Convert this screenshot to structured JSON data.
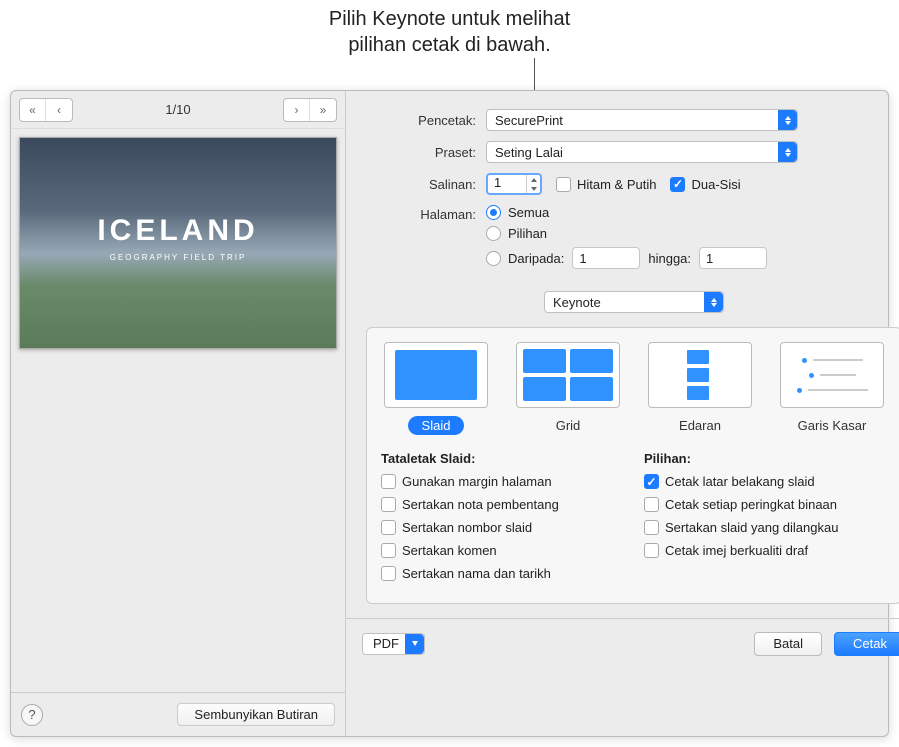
{
  "annotation": {
    "line1": "Pilih Keynote untuk melihat",
    "line2": "pilihan cetak di bawah."
  },
  "preview": {
    "page_indicator": "1/10",
    "slide_title": "ICELAND",
    "slide_subtitle": "GEOGRAPHY FIELD TRIP"
  },
  "left_footer": {
    "hide_details": "Sembunyikan Butiran"
  },
  "form": {
    "printer_label": "Pencetak:",
    "printer_value": "SecurePrint",
    "preset_label": "Praset:",
    "preset_value": "Seting Lalai",
    "copies_label": "Salinan:",
    "copies_value": "1",
    "bw_label": "Hitam & Putih",
    "twosided_label": "Dua-Sisi",
    "pages_label": "Halaman:",
    "pages_all": "Semua",
    "pages_sel": "Pilihan",
    "pages_from": "Daripada:",
    "from_value": "1",
    "pages_to": "hingga:",
    "to_value": "1",
    "app_value": "Keynote"
  },
  "layouts": {
    "slide": "Slaid",
    "grid": "Grid",
    "handout": "Edaran",
    "outline": "Garis Kasar"
  },
  "options": {
    "layout_title": "Tataletak Slaid:",
    "choices_title": "Pilihan:",
    "margins": "Gunakan margin halaman",
    "presenter": "Sertakan nota pembentang",
    "slideno": "Sertakan nombor slaid",
    "comments": "Sertakan komen",
    "namedate": "Sertakan nama dan tarikh",
    "bg": "Cetak latar belakang slaid",
    "builds": "Cetak setiap peringkat binaan",
    "skipped": "Sertakan slaid yang dilangkau",
    "draft": "Cetak imej berkualiti draf"
  },
  "bottom": {
    "pdf": "PDF",
    "cancel": "Batal",
    "print": "Cetak"
  }
}
